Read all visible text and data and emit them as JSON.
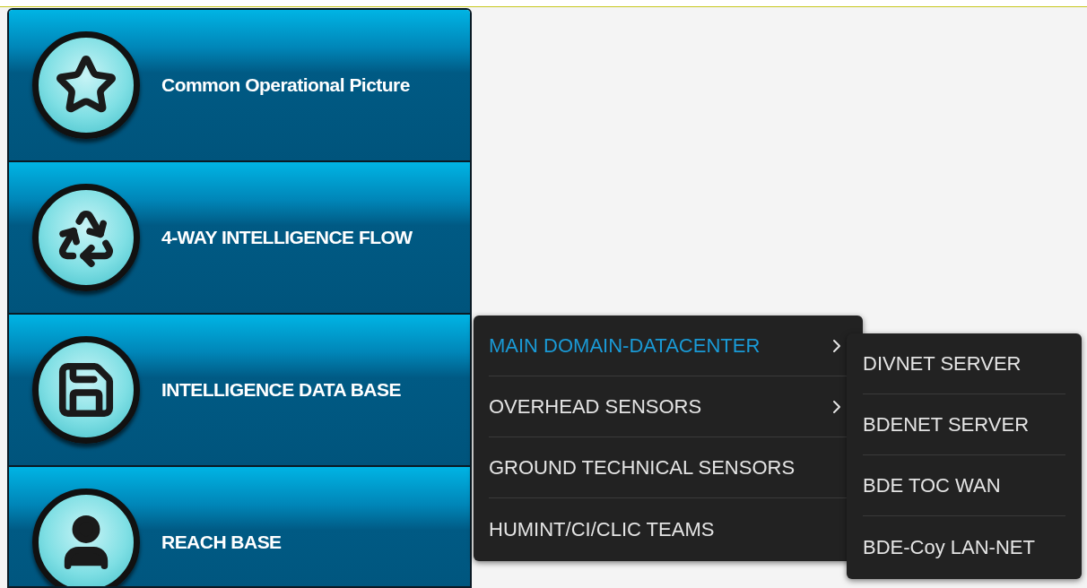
{
  "tiles": [
    {
      "label": "Common Operational Picture"
    },
    {
      "label": "4-WAY INTELLIGENCE FLOW"
    },
    {
      "label": "INTELLIGENCE DATA BASE"
    },
    {
      "label": "REACH BASE"
    }
  ],
  "menu": {
    "items": [
      {
        "label": "MAIN DOMAIN-DATACENTER",
        "selected": true,
        "has_submenu": true
      },
      {
        "label": "OVERHEAD SENSORS",
        "selected": false,
        "has_submenu": true
      },
      {
        "label": "GROUND TECHNICAL SENSORS",
        "selected": false,
        "has_submenu": false
      },
      {
        "label": "HUMINT/CI/CLIC TEAMS",
        "selected": false,
        "has_submenu": false
      }
    ]
  },
  "submenu": {
    "items": [
      {
        "label": "DIVNET SERVER"
      },
      {
        "label": "BDENET SERVER"
      },
      {
        "label": "BDE TOC WAN"
      },
      {
        "label": "BDE-Coy LAN-NET"
      }
    ]
  }
}
